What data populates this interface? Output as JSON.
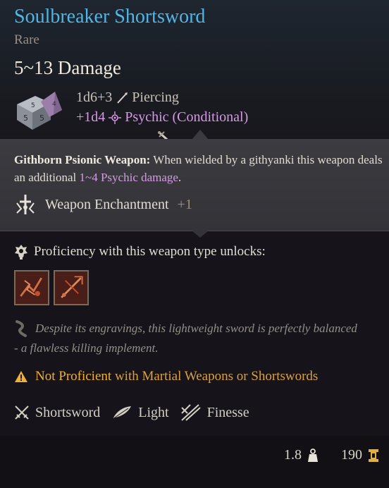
{
  "item": {
    "name": "Soulbreaker Shortsword",
    "rarity": "Rare",
    "damage_range": "5~13 Damage",
    "damage_lines": [
      {
        "dice": "1d6+3",
        "type": "Piercing",
        "icon": "piercing-icon"
      },
      {
        "dice": "+1d4",
        "type": "Psychic (Conditional)",
        "icon": "psychic-icon"
      }
    ]
  },
  "passive": {
    "title": "Githborn Psionic Weapon:",
    "text_before": " When wielded by a githyanki this weapon deals an additional ",
    "highlight": "1~4 Psychic damage",
    "text_after": "."
  },
  "enchantment": {
    "label": "Weapon Enchantment",
    "value": "+1"
  },
  "proficiency": {
    "label": "Proficiency with this weapon type unlocks:",
    "actions": [
      "action-icon-1",
      "action-icon-2"
    ]
  },
  "lore": {
    "line1": "Despite its engravings, this lightweight sword is perfectly balanced",
    "line2": "- a flawless killing implement."
  },
  "warning": {
    "part1": "Not Proficient",
    "part2": " with Martial Weapons or Shortswords"
  },
  "properties": [
    {
      "label": "Shortsword",
      "icon": "crossed-swords-icon"
    },
    {
      "label": "Light",
      "icon": "feather-icon"
    },
    {
      "label": "Finesse",
      "icon": "finesse-icon"
    }
  ],
  "footer": {
    "weight": "1.8",
    "value": "190"
  },
  "colors": {
    "title": "#4fb6e8",
    "psychic": "#d59ae4",
    "warning": "#f0b030",
    "muted": "#9a8e80"
  }
}
